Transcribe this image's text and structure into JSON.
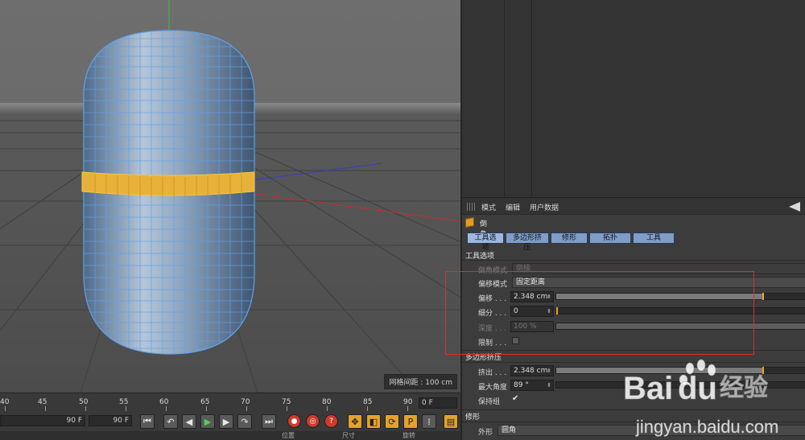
{
  "viewport": {
    "grid_spacing_label": "网格间距 : 100 cm"
  },
  "timeline": {
    "ticks": [
      "40",
      "45",
      "50",
      "55",
      "60",
      "65",
      "70",
      "75",
      "80",
      "85",
      "90"
    ],
    "current_frame": "0 F",
    "end_frame_a": "90 F",
    "end_frame_b": "90 F",
    "bottom_labels": [
      "位置",
      "尺寸",
      "旋转"
    ]
  },
  "attributes": {
    "menu": [
      "模式",
      "编辑",
      "用户数据"
    ],
    "tool_name": "倒角",
    "tabs": [
      "工具选项",
      "多边形挤压",
      "修形",
      "拓扑",
      "工具"
    ],
    "section_tool_options": "工具选项",
    "bevel_mode_label": "倒角模式",
    "bevel_mode_value": "倒棱",
    "offset_mode_label": "偏移模式",
    "offset_mode_value": "固定距离",
    "offset_label": "偏移 . . .",
    "offset_value": "2.348 cm",
    "offset_fraction": 0.83,
    "subdivision_label": "细分 . . .",
    "subdivision_value": "0",
    "subdivision_fraction": 0.0,
    "depth_label": "深度 . . .",
    "depth_value": "100 %",
    "limit_label": "限制 . . .",
    "section_polygon_extrude": "多边形挤压",
    "extrude_label": "挤出 . . .",
    "extrude_value": "2.348 cm",
    "extrude_fraction": 0.83,
    "max_angle_label": "最大角度",
    "max_angle_value": "89 °",
    "preserve_label": "保持组",
    "section_shaping": "修形",
    "shape_label": "外形",
    "shape_value": "圆角"
  },
  "watermark": {
    "brand_left": "Bai",
    "brand_right": "du",
    "cn_text": "经验",
    "url": "jingyan.baidu.com"
  },
  "colors": {
    "accent_orange": "#f1a21c",
    "tab_blue": "#7f9dc8",
    "selection_ring": "#e8b23a",
    "mesh_wire": "#5fa2e8",
    "highlight_box": "#d9312a"
  }
}
